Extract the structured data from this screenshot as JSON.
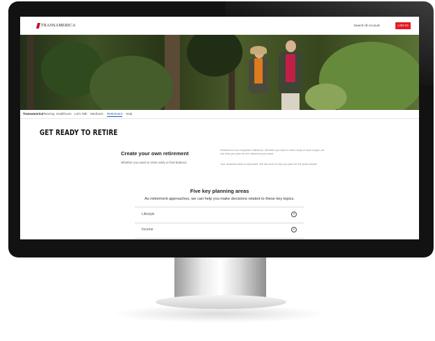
{
  "header": {
    "logo_text": "TRANSAMERICA",
    "search_account_label": "Search All Account",
    "login_label": "LOG IN"
  },
  "nav": {
    "items": [
      "Transamerica",
      "Planning",
      "Healthcare",
      "Let's Talk",
      "Medicare",
      "Retirement",
      "Help"
    ],
    "active_item": "Retirement"
  },
  "main": {
    "page_title": "GET READY TO RETIRE",
    "create": {
      "heading": "Create your own retirement",
      "subtext": "Whether you want to retire early or find balance."
    },
    "description_paragraphs": [
      "Retirement is an important milestone. Whether you want to retire early or work longer, we can help you plan for the retirement you want.",
      "Your financial future is important. We are here to help you plan for the years ahead."
    ],
    "five_areas": {
      "heading": "Five key planning areas",
      "subheading": "As retirement approaches, we can help you make decisions related to these key topics."
    },
    "accordion": [
      {
        "label": "Lifestyle",
        "icon": "plus-circle-icon"
      },
      {
        "label": "Income",
        "icon": "plus-circle-icon"
      }
    ]
  },
  "colors": {
    "brand_red": "#e41b23",
    "active_nav": "#1a5fb4",
    "bezel": "#121212"
  }
}
